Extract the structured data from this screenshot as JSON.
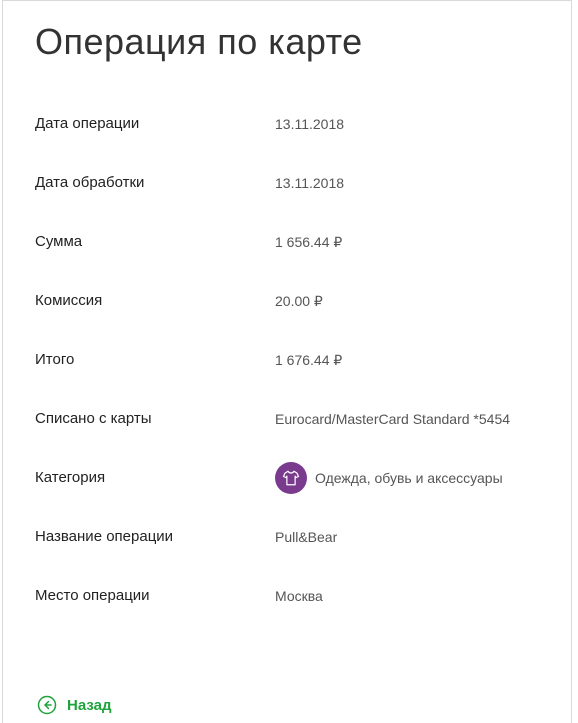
{
  "page": {
    "title": "Операция по карте"
  },
  "details": {
    "rows": [
      {
        "label": "Дата операции",
        "value": "13.11.2018"
      },
      {
        "label": "Дата обработки",
        "value": "13.11.2018"
      },
      {
        "label": "Сумма",
        "value": "1 656.44 ₽"
      },
      {
        "label": "Комиссия",
        "value": "20.00 ₽"
      },
      {
        "label": "Итого",
        "value": "1 676.44 ₽"
      },
      {
        "label": "Списано с карты",
        "value": "Eurocard/MasterCard Standard *5454"
      },
      {
        "label": "Категория",
        "value": "Одежда, обувь и аксессуары",
        "icon": "tshirt-icon"
      },
      {
        "label": "Название операции",
        "value": "Pull&Bear"
      },
      {
        "label": "Место операции",
        "value": "Москва"
      }
    ]
  },
  "footer": {
    "back_label": "Назад",
    "back_icon": "arrow-left-circle-icon"
  },
  "colors": {
    "accent": "#1fa33c",
    "category_badge": "#7a3b8f"
  }
}
